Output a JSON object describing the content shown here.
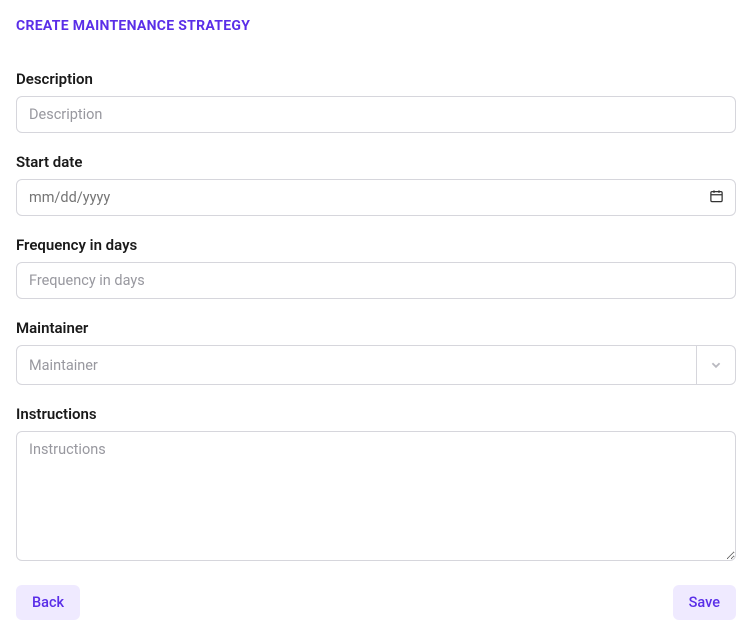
{
  "header": {
    "title": "CREATE MAINTENANCE STRATEGY"
  },
  "form": {
    "description": {
      "label": "Description",
      "placeholder": "Description",
      "value": ""
    },
    "start_date": {
      "label": "Start date",
      "placeholder": "mm/dd/yyyy",
      "value": ""
    },
    "frequency": {
      "label": "Frequency in days",
      "placeholder": "Frequency in days",
      "value": ""
    },
    "maintainer": {
      "label": "Maintainer",
      "placeholder": "Maintainer",
      "value": ""
    },
    "instructions": {
      "label": "Instructions",
      "placeholder": "Instructions",
      "value": ""
    }
  },
  "buttons": {
    "back": "Back",
    "save": "Save"
  }
}
